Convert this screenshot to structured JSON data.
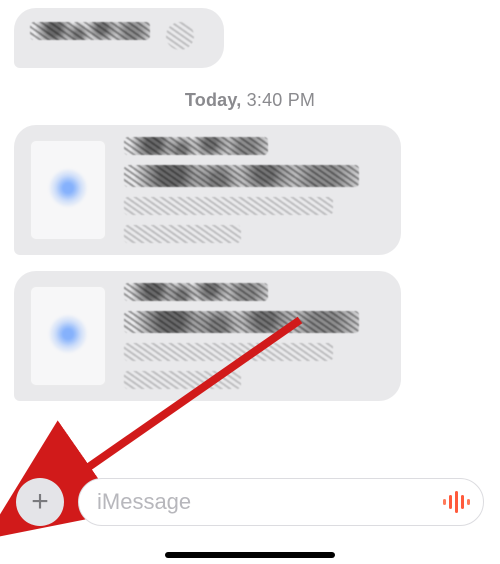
{
  "timestamp": {
    "day": "Today",
    "time": "3:40 PM"
  },
  "composer": {
    "placeholder": "iMessage",
    "value": ""
  },
  "colors": {
    "bubble": "#e9e9eb",
    "placeholder": "#b7b7bc",
    "accent": "#ff5a3c"
  },
  "messages": [
    {
      "kind": "small",
      "redacted": true
    },
    {
      "kind": "rich",
      "redacted": true
    },
    {
      "kind": "rich",
      "redacted": true
    }
  ],
  "annotation": {
    "arrow_target": "add-button"
  }
}
